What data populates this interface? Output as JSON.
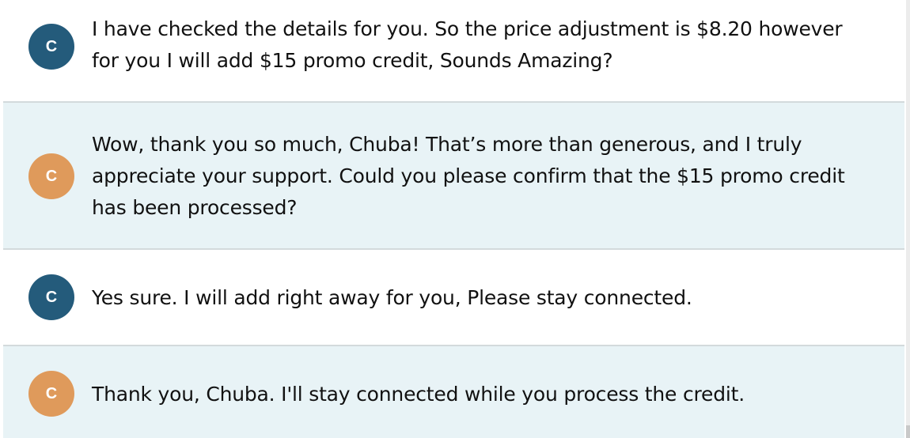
{
  "messages": [
    {
      "sender": "agent",
      "avatar_initial": "C",
      "text_lines": [
        "I have checked the details for you. So the price adjustment is $8.20 however",
        "for you I will add $15 promo credit, Sounds Amazing?"
      ]
    },
    {
      "sender": "customer",
      "avatar_initial": "C",
      "text_lines": [
        "Wow, thank you so much, Chuba! That’s more than generous, and I truly",
        "appreciate your support. Could you please confirm that the $15 promo credit",
        "has been processed?"
      ]
    },
    {
      "sender": "agent",
      "avatar_initial": "C",
      "text_lines": [
        "Yes sure. I will add right away for you, Please stay connected."
      ]
    },
    {
      "sender": "customer",
      "avatar_initial": "C",
      "text_lines": [
        "Thank you, Chuba. I'll stay connected while you process the credit."
      ]
    }
  ],
  "colors": {
    "agent_avatar": "#245b7b",
    "customer_avatar": "#df9a5b",
    "customer_bg": "#e8f3f6",
    "agent_bg": "#ffffff",
    "divider": "#d3dadc"
  }
}
